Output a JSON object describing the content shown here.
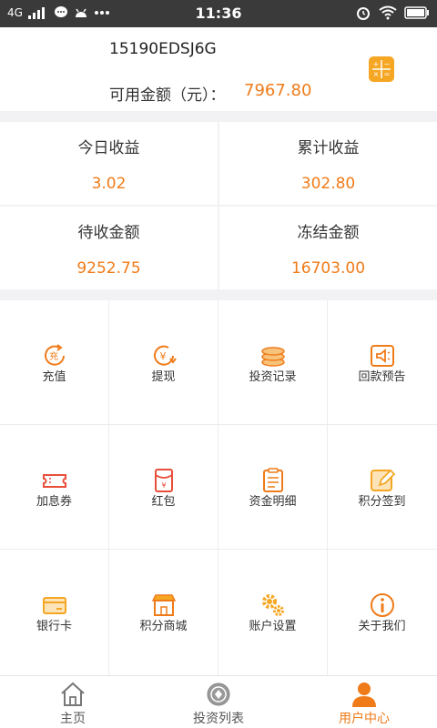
{
  "status_bar": {
    "network": "4G",
    "time": "11:36"
  },
  "account": {
    "id": "15190EDSJ6G",
    "balance_label": "可用金额（元）：",
    "balance_value": "7967.80"
  },
  "stats": {
    "today_label": "今日收益",
    "today_value": "3.02",
    "total_label": "累计收益",
    "total_value": "302.80",
    "pending_label": "待收金额",
    "pending_value": "9252.75",
    "frozen_label": "冻结金额",
    "frozen_value": "16703.00"
  },
  "menu": [
    {
      "label": "充值",
      "icon": "recharge-icon"
    },
    {
      "label": "提现",
      "icon": "withdraw-icon"
    },
    {
      "label": "投资记录",
      "icon": "coins-icon"
    },
    {
      "label": "回款预告",
      "icon": "announcement-icon"
    },
    {
      "label": "加息券",
      "icon": "ticket-icon"
    },
    {
      "label": "红包",
      "icon": "red-envelope-icon"
    },
    {
      "label": "资金明细",
      "icon": "document-icon"
    },
    {
      "label": "积分签到",
      "icon": "signin-icon"
    },
    {
      "label": "银行卡",
      "icon": "bank-card-icon"
    },
    {
      "label": "积分商城",
      "icon": "shop-icon"
    },
    {
      "label": "账户设置",
      "icon": "gear-icon"
    },
    {
      "label": "关于我们",
      "icon": "info-icon"
    }
  ],
  "tabbar": {
    "home": "主页",
    "invest_list": "投资列表",
    "user_center": "用户中心"
  },
  "colors": {
    "accent": "#f07b19",
    "status_bar": "#3a3a3a"
  }
}
